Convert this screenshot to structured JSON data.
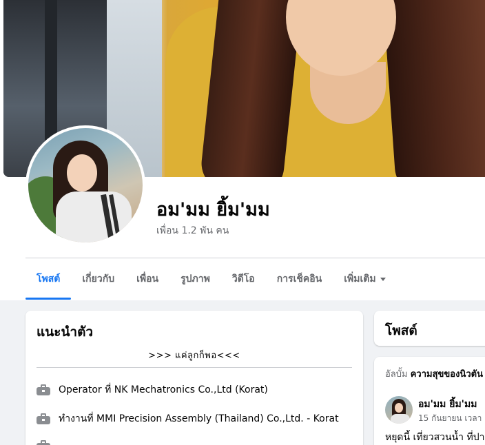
{
  "profile": {
    "name": "อม'มม ยิ้ม'มม",
    "friends_count": "เพื่อน 1.2 พัน คน"
  },
  "tabs": [
    {
      "label": "โพสต์",
      "active": true
    },
    {
      "label": "เกี่ยวกับ",
      "active": false
    },
    {
      "label": "เพื่อน",
      "active": false
    },
    {
      "label": "รูปภาพ",
      "active": false
    },
    {
      "label": "วิดีโอ",
      "active": false
    },
    {
      "label": "การเช็คอิน",
      "active": false
    },
    {
      "label": "เพิ่มเติม",
      "active": false
    }
  ],
  "intro": {
    "title": "แนะนำตัว",
    "bio": ">>> แค่ลูกก็พอ<<<",
    "items": [
      {
        "icon": "briefcase-icon",
        "prefix": "Operator ที่ ",
        "place": "NK Mechatronics Co.,Ltd (Korat)"
      },
      {
        "icon": "briefcase-icon",
        "prefix": "ทำงานที่ ",
        "place": "MMI Precision Assembly (Thailand) Co.,Ltd. - Korat"
      }
    ]
  },
  "posts_panel": {
    "title": "โพสต์"
  },
  "post": {
    "album_prefix": "อัลบั้ม ",
    "album_name": "ความสุขของนิวตัน",
    "author": "อม'มม ยิ้ม'มม",
    "date": "15 กันยายน เวลา",
    "text": "หยุดนี้ เที่ยวสวนน้ำ ที่ปา"
  },
  "colors": {
    "accent": "#1877f2",
    "secondary_text": "#65676b",
    "background": "#f0f2f5"
  }
}
